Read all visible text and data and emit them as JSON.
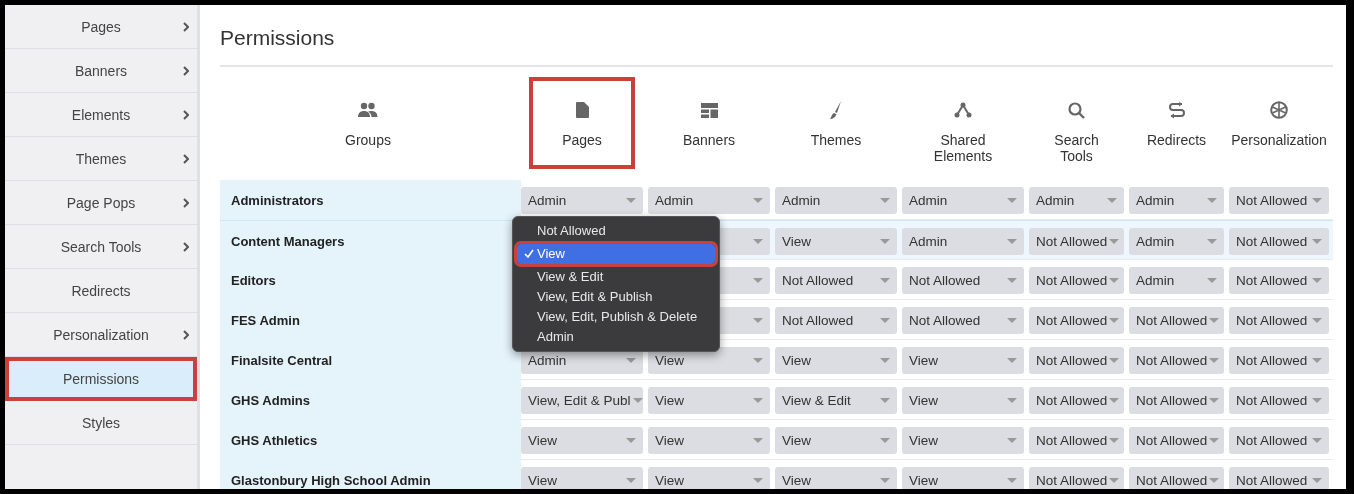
{
  "sidebar": {
    "items": [
      {
        "label": "Pages",
        "submenu": true,
        "selected": false,
        "highlighted": false
      },
      {
        "label": "Banners",
        "submenu": true,
        "selected": false,
        "highlighted": false
      },
      {
        "label": "Elements",
        "submenu": true,
        "selected": false,
        "highlighted": false
      },
      {
        "label": "Themes",
        "submenu": true,
        "selected": false,
        "highlighted": false
      },
      {
        "label": "Page Pops",
        "submenu": true,
        "selected": false,
        "highlighted": false
      },
      {
        "label": "Search Tools",
        "submenu": true,
        "selected": false,
        "highlighted": false
      },
      {
        "label": "Redirects",
        "submenu": false,
        "selected": false,
        "highlighted": false
      },
      {
        "label": "Personalization",
        "submenu": true,
        "selected": false,
        "highlighted": false
      },
      {
        "label": "Permissions",
        "submenu": false,
        "selected": true,
        "highlighted": true
      },
      {
        "label": "Styles",
        "submenu": false,
        "selected": false,
        "highlighted": false
      }
    ]
  },
  "title": "Permissions",
  "table": {
    "group_column": {
      "label": "Groups",
      "highlighted": false
    },
    "columns": [
      {
        "label": "Pages",
        "highlighted": true
      },
      {
        "label": "Banners",
        "highlighted": false
      },
      {
        "label": "Themes",
        "highlighted": false
      },
      {
        "label": "Shared Elements",
        "highlighted": false
      },
      {
        "label": "Search Tools",
        "highlighted": false
      },
      {
        "label": "Redirects",
        "highlighted": false
      },
      {
        "label": "Personalization",
        "highlighted": false
      }
    ],
    "rows": [
      {
        "group": "Administrators",
        "selected": false,
        "cells": [
          {
            "value": "Admin"
          },
          {
            "value": "Admin"
          },
          {
            "value": "Admin"
          },
          {
            "value": "Admin"
          },
          {
            "value": "Admin"
          },
          {
            "value": "Admin"
          },
          {
            "value": "Not Allowed"
          }
        ]
      },
      {
        "group": "Content Managers",
        "selected": true,
        "cells": [
          {
            "menu": {
              "options": [
                {
                  "label": "Not Allowed",
                  "selected": false,
                  "highlighted": false
                },
                {
                  "label": "View",
                  "selected": true,
                  "highlighted": true
                },
                {
                  "label": "View & Edit",
                  "selected": false,
                  "highlighted": false
                },
                {
                  "label": "View, Edit & Publish",
                  "selected": false,
                  "highlighted": false
                },
                {
                  "label": "View, Edit, Publish & Delete",
                  "selected": false,
                  "highlighted": false
                },
                {
                  "label": "Admin",
                  "selected": false,
                  "highlighted": false
                }
              ]
            }
          },
          {},
          {
            "value": "View"
          },
          {
            "value": "Admin"
          },
          {
            "value": "Not Allowed"
          },
          {
            "value": "Admin"
          },
          {
            "value": "Not Allowed"
          }
        ]
      },
      {
        "group": "Editors",
        "selected": false,
        "cells": [
          {},
          {},
          {
            "value": "Not Allowed"
          },
          {
            "value": "Not Allowed"
          },
          {
            "value": "Not Allowed"
          },
          {
            "value": "Admin"
          },
          {
            "value": "Not Allowed"
          }
        ]
      },
      {
        "group": "FES Admin",
        "selected": false,
        "cells": [
          {},
          {},
          {
            "value": "Not Allowed"
          },
          {
            "value": "Not Allowed"
          },
          {
            "value": "Not Allowed"
          },
          {
            "value": "Not Allowed"
          },
          {
            "value": "Not Allowed"
          }
        ]
      },
      {
        "group": "Finalsite Central",
        "selected": false,
        "cells": [
          {
            "value": "Admin"
          },
          {
            "value": "View"
          },
          {
            "value": "View"
          },
          {
            "value": "View"
          },
          {
            "value": "Not Allowed"
          },
          {
            "value": "Not Allowed"
          },
          {
            "value": "Not Allowed"
          }
        ]
      },
      {
        "group": "GHS Admins",
        "selected": false,
        "cells": [
          {
            "value": "View, Edit & Publ"
          },
          {
            "value": "View"
          },
          {
            "value": "View & Edit"
          },
          {
            "value": "View"
          },
          {
            "value": "Not Allowed"
          },
          {
            "value": "Not Allowed"
          },
          {
            "value": "Not Allowed"
          }
        ]
      },
      {
        "group": "GHS Athletics",
        "selected": false,
        "cells": [
          {
            "value": "View"
          },
          {
            "value": "View"
          },
          {
            "value": "View"
          },
          {
            "value": "View"
          },
          {
            "value": "Not Allowed"
          },
          {
            "value": "Not Allowed"
          },
          {
            "value": "Not Allowed"
          }
        ]
      },
      {
        "group": "Glastonbury High School Admin",
        "selected": false,
        "cells": [
          {
            "value": "View"
          },
          {
            "value": "View"
          },
          {
            "value": "View"
          },
          {
            "value": "View"
          },
          {
            "value": "Not Allowed"
          },
          {
            "value": "Not Allowed"
          },
          {
            "value": "Not Allowed"
          }
        ]
      }
    ]
  }
}
